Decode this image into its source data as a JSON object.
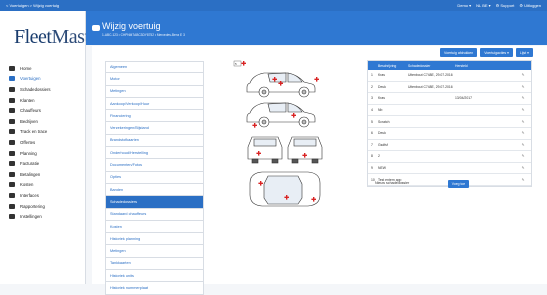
{
  "topbar": {
    "breadcrumb": "< Voertuigen > Wijzig voertuig",
    "status": "Demo ▾",
    "lang": "NL BE ▾",
    "support": "⚙ Support",
    "user": "⚙ Uitloggen"
  },
  "app": {
    "logo_fleet": "Fleet",
    "logo_master": "Master"
  },
  "sidebar": {
    "items": [
      {
        "label": "Home",
        "icon": "home-icon"
      },
      {
        "label": "Voertuigen",
        "icon": "car-icon",
        "active": true
      },
      {
        "label": "Schadedossiers",
        "icon": "warning-icon"
      },
      {
        "label": "Klanten",
        "icon": "user-icon"
      },
      {
        "label": "Chauffeurs",
        "icon": "driver-icon"
      },
      {
        "label": "Bedrijven",
        "icon": "building-icon"
      },
      {
        "label": "Track en trace",
        "icon": "monitor-icon"
      },
      {
        "label": "Offertes",
        "icon": "cart-icon"
      },
      {
        "label": "Planning",
        "icon": "calendar-icon"
      },
      {
        "label": "Facturatie",
        "icon": "invoice-icon"
      },
      {
        "label": "Betalingen",
        "icon": "payment-icon"
      },
      {
        "label": "Kosten",
        "icon": "cost-icon"
      },
      {
        "label": "Interfaces",
        "icon": "plug-icon"
      },
      {
        "label": "Rapportering",
        "icon": "chart-icon"
      },
      {
        "label": "Instellingen",
        "icon": "gear-icon"
      }
    ]
  },
  "header": {
    "title": "Wijzig voertuig",
    "subtitle": "1-ABC-123 • CHPNM7ABC3DY8752 • Mercedes-Benz E 3"
  },
  "tabs": [
    {
      "label": "Algemeen"
    },
    {
      "label": "Motor"
    },
    {
      "label": "Metingen"
    },
    {
      "label": "Aankoop/Verkoop/Huur"
    },
    {
      "label": "Financiering"
    },
    {
      "label": "Verzekeringen/Bijstand"
    },
    {
      "label": "Brandstofkaarten"
    },
    {
      "label": "Onderhoud/Herstelling"
    },
    {
      "label": "Documenten/Fotos"
    },
    {
      "label": "Opties"
    },
    {
      "label": "Banden"
    },
    {
      "label": "Schadedossiers",
      "active": true
    },
    {
      "label": "Standaard chauffeurs"
    },
    {
      "label": "Kosten"
    },
    {
      "label": "Historiek planning"
    },
    {
      "label": "Metingen"
    },
    {
      "label": "Tankkaarten"
    },
    {
      "label": "Historiek units"
    },
    {
      "label": "Historiek nummerplaat"
    }
  ],
  "buttons": {
    "export": "Voertuig afdrukken",
    "actions": "Voertuigacties ▾",
    "more": "Lijst ▾"
  },
  "table": {
    "headers": [
      "",
      "Beschrijving",
      "Schadedossier",
      "Hersteld",
      ""
    ],
    "rows": [
      [
        "1",
        "Kras",
        "Uitenbout C748E, 29.07.2016",
        "",
        "✎"
      ],
      [
        "2",
        "Deuk",
        "Uitenbout C748E, 29.07.2016",
        "",
        "✎"
      ],
      [
        "3",
        "Kras",
        "",
        "13/04/2017",
        "✎"
      ],
      [
        "4",
        "Nb",
        "",
        "",
        "✎"
      ],
      [
        "5",
        "Scratch",
        "",
        "",
        "✎"
      ],
      [
        "6",
        "Deuk",
        "",
        "",
        "✎"
      ],
      [
        "7",
        "Gsdfsf",
        "",
        "",
        "✎"
      ],
      [
        "8",
        "2",
        "",
        "",
        "✎"
      ],
      [
        "9",
        "NEW",
        "",
        "",
        "✎"
      ],
      [
        "10",
        "Test entern app",
        "",
        "",
        "✎"
      ]
    ]
  },
  "footer": {
    "new_label": "Nieuw schadedossier",
    "add_button": "Voeg toe"
  }
}
